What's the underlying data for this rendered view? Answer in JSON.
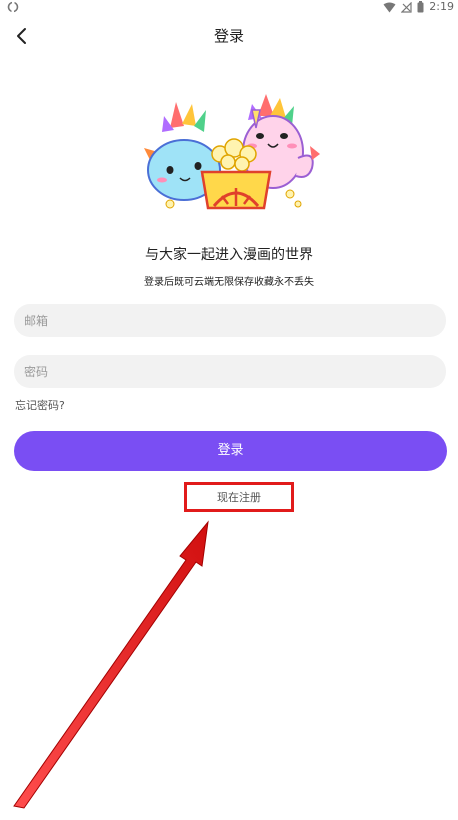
{
  "status_bar": {
    "time": "2:19",
    "icons": [
      "sync-icon",
      "wifi-icon",
      "no-signal-icon",
      "battery-icon"
    ]
  },
  "header": {
    "title": "登录",
    "back_icon": "chevron-left-icon"
  },
  "hero": {
    "headline": "与大家一起进入漫画的世界",
    "subline": "登录后既可云端无限保存收藏永不丢失"
  },
  "form": {
    "email_placeholder": "邮箱",
    "email_value": "",
    "password_placeholder": "密码",
    "password_value": "",
    "forgot_label": "忘记密码?"
  },
  "actions": {
    "login_label": "登录",
    "register_label": "现在注册"
  },
  "colors": {
    "accent": "#7a4ef3",
    "annotation": "#e11b1b",
    "field_bg": "#f2f2f2"
  }
}
